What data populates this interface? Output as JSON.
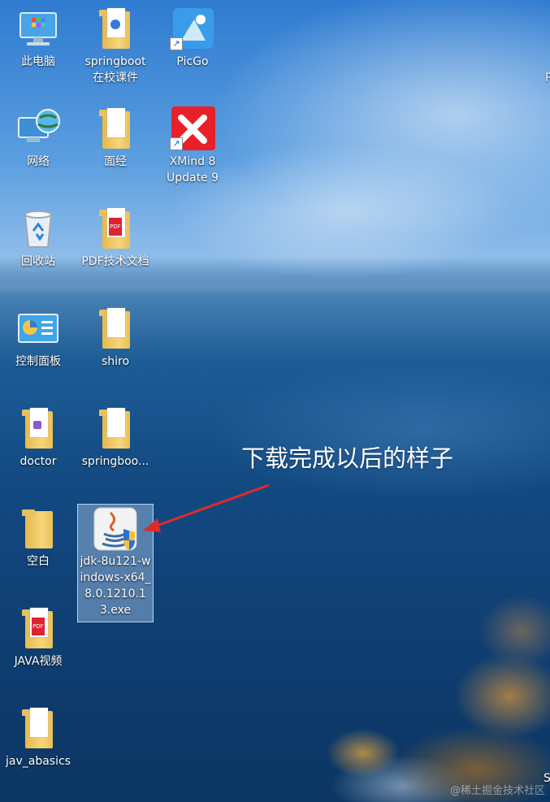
{
  "desktop": {
    "icons": [
      {
        "label": "此电脑",
        "icon": "computer-icon"
      },
      {
        "label": "springboot\n在校课件",
        "icon": "folder-icon"
      },
      {
        "label": "PicGo",
        "icon": "picgo-app-icon"
      },
      {
        "label": "网络",
        "icon": "network-icon"
      },
      {
        "label": "面经",
        "icon": "folder-icon"
      },
      {
        "label": "XMind 8\nUpdate 9",
        "icon": "xmind-app-icon"
      },
      {
        "label": "回收站",
        "icon": "recycle-bin-icon"
      },
      {
        "label": "PDF技术文档",
        "icon": "folder-icon"
      },
      {
        "label": "控制面板",
        "icon": "control-panel-icon"
      },
      {
        "label": "shiro",
        "icon": "folder-icon"
      },
      {
        "label": "doctor",
        "icon": "folder-icon"
      },
      {
        "label": "springboo...",
        "icon": "folder-icon"
      },
      {
        "label": "空白",
        "icon": "folder-icon"
      },
      {
        "label": "jdk-8u121-windows-x64_8.0.1210.13.exe",
        "icon": "java-installer-icon"
      },
      {
        "label": "JAVA视频",
        "icon": "folder-icon"
      },
      {
        "label": "jav_abasics",
        "icon": "folder-icon"
      }
    ]
  },
  "annotation": {
    "text": "下载完成以后的样子",
    "color": "#e02a2a"
  },
  "partial_texts": {
    "top_right": "P",
    "bottom_right": "S"
  },
  "watermark": "@稀土掘金技术社区"
}
